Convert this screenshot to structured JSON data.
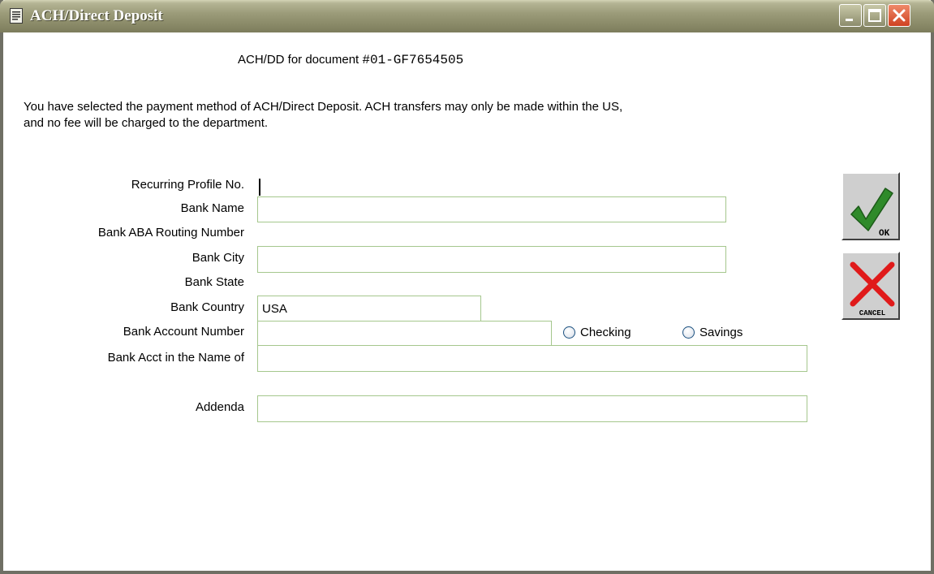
{
  "window": {
    "title": "ACH/Direct Deposit"
  },
  "header": {
    "doc_prefix": "ACH/DD for document ",
    "doc_number": "#01-GF7654505"
  },
  "notice": {
    "line1": "You have selected the payment method of ACH/Direct Deposit.  ACH transfers may only be made within the US,",
    "line2": "and no fee will be charged to the department."
  },
  "form": {
    "recurring_profile_label": "Recurring Profile No.",
    "recurring_profile_value": "",
    "bank_name_label": "Bank Name",
    "bank_name_value": "",
    "aba_routing_label": "Bank ABA Routing Number",
    "aba_routing_value": "",
    "bank_city_label": "Bank City",
    "bank_city_value": "",
    "bank_state_label": "Bank State",
    "bank_state_value": "",
    "bank_country_label": "Bank Country",
    "bank_country_value": "USA",
    "account_number_label": "Bank Account Number",
    "account_number_value": "",
    "account_type_options": [
      "Checking",
      "Savings"
    ],
    "account_name_label": "Bank Acct in the Name of",
    "account_name_value": "",
    "addenda_label": "Addenda",
    "addenda_value": ""
  },
  "buttons": {
    "ok_label": "OK",
    "cancel_label": "CANCEL"
  },
  "colors": {
    "field_border": "#a5c78d",
    "ok_check": "#2f8a2a",
    "cancel_x": "#e01a1a",
    "close_button": "#d24a2a"
  },
  "icons": {
    "title": "document-icon",
    "ok": "checkmark-icon",
    "cancel": "x-icon"
  }
}
